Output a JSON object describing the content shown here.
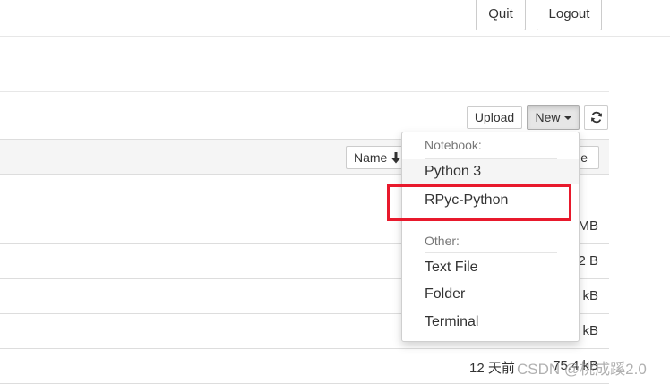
{
  "header": {
    "quit_label": "Quit",
    "logout_label": "Logout"
  },
  "toolbar": {
    "upload_label": "Upload",
    "new_label": "New",
    "refresh_icon": "refresh-icon"
  },
  "file_list": {
    "columns": {
      "name_label": "Name",
      "sort_icon": "arrow-down-icon",
      "size_label": "ze"
    },
    "rows": [
      {
        "size": "MB"
      },
      {
        "size": "2 B"
      },
      {
        "size": "kB"
      },
      {
        "size": "kB"
      },
      {
        "modified": "12 天前",
        "size": "75.4 kB"
      }
    ]
  },
  "new_menu": {
    "notebook_header": "Notebook:",
    "notebook_items": [
      "Python 3",
      "RPyc-Python"
    ],
    "other_header": "Other:",
    "other_items": [
      "Text File",
      "Folder",
      "Terminal"
    ]
  },
  "annotation": {
    "highlight_color": "#e8192c"
  },
  "watermark": {
    "text": "CSDN @桃成蹊2.0"
  }
}
